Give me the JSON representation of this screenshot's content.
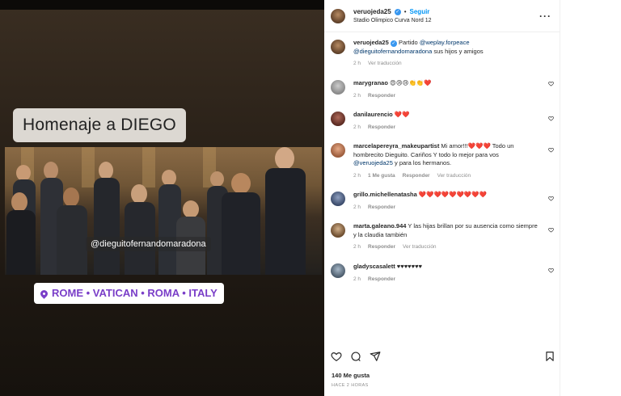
{
  "post": {
    "author": "veruojeda25",
    "follow_label": "Seguir",
    "separator": "•",
    "location": "Stadio Olimpico Curva Nord 12",
    "more_icon": "more-horizontal-icon"
  },
  "media": {
    "title_sticker": "Homenaje a DIEGO",
    "mention_sticker": "@dieguitofernandomaradona",
    "location_sticker": "ROME • VATICAN • ROMA • ITALY",
    "location_color": "#7a3ec8"
  },
  "caption": {
    "user": "veruojeda25",
    "verified": "✓",
    "text_before": "Partido ",
    "mention1": "@weplay.forpeace",
    "mention2": "@dieguitofernandomaradona",
    "text_after": " sus hijos y amigos",
    "time": "2 h",
    "translate": "Ver traducción"
  },
  "comments": [
    {
      "user": "marygranao",
      "text": "",
      "emoji": "😍😢😢👏👏❤️",
      "time": "2 h",
      "reply": "Responder",
      "likes": "",
      "translate": ""
    },
    {
      "user": "danilaurencio",
      "text": "",
      "emoji": "❤️❤️",
      "time": "2 h",
      "reply": "Responder",
      "likes": "",
      "translate": ""
    },
    {
      "user": "marcelapereyra_makeupartist",
      "text": "Mi amor!!!",
      "emoji": "❤️❤️❤️",
      "text2": " Todo un hombrecito Dieguito. Cariños Y todo lo mejor para vos ",
      "mention": "@veruojeda25",
      "text3": " y para los hermanos.",
      "time": "2 h",
      "reply": "Responder",
      "likes": "1 Me gusta",
      "translate": "Ver traducción"
    },
    {
      "user": "grillo.michellenatasha",
      "text": "",
      "emoji": "❤️❤️❤️❤️❤️❤️❤️❤️❤️",
      "time": "2 h",
      "reply": "Responder",
      "likes": "",
      "translate": ""
    },
    {
      "user": "marta.galeano.944",
      "text": "Y las hijas brillan por su ausencia como siempre y la claudia también",
      "emoji": "",
      "time": "2 h",
      "reply": "Responder",
      "likes": "",
      "translate": "Ver traducción"
    },
    {
      "user": "gladyscasalett",
      "text": "",
      "emoji": "♥♥♥♥♥♥♥",
      "time": "2 h",
      "reply": "Responder",
      "likes": "",
      "translate": ""
    }
  ],
  "footer": {
    "likes": "140 Me gusta",
    "ago": "HACE 2 HORAS",
    "icons": [
      "heart-icon",
      "comment-icon",
      "share-icon",
      "bookmark-icon"
    ]
  }
}
